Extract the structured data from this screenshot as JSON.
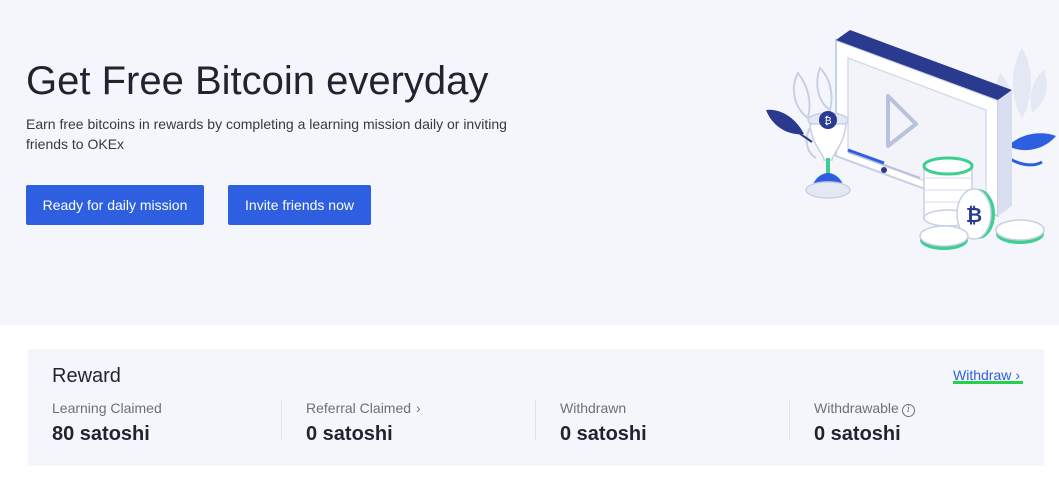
{
  "hero": {
    "title": "Get Free Bitcoin everyday",
    "subtitle": "Earn free bitcoins in rewards by completing a learning mission daily or inviting friends to OKEx",
    "daily_button": "Ready for daily mission",
    "invite_button": "Invite friends now"
  },
  "reward": {
    "title": "Reward",
    "withdraw_link": "Withdraw",
    "stats": [
      {
        "label": "Learning Claimed",
        "value": "80 satoshi",
        "icon": null
      },
      {
        "label": "Referral Claimed",
        "value": "0 satoshi",
        "icon": "chevron-right-icon"
      },
      {
        "label": "Withdrawn",
        "value": "0 satoshi",
        "icon": null
      },
      {
        "label": "Withdrawable",
        "value": "0 satoshi",
        "icon": "info-icon"
      }
    ]
  },
  "icons": {
    "bitcoin_symbol": "₿",
    "info_symbol": "i",
    "chevron": "›"
  },
  "colors": {
    "primary": "#2d5fe0",
    "hero_bg": "#f5f6fb",
    "card_bg": "#f5f6fb",
    "accent_green": "#23d14a",
    "coin_green": "#3ccf8e",
    "dark_navy": "#2a3a8f"
  }
}
